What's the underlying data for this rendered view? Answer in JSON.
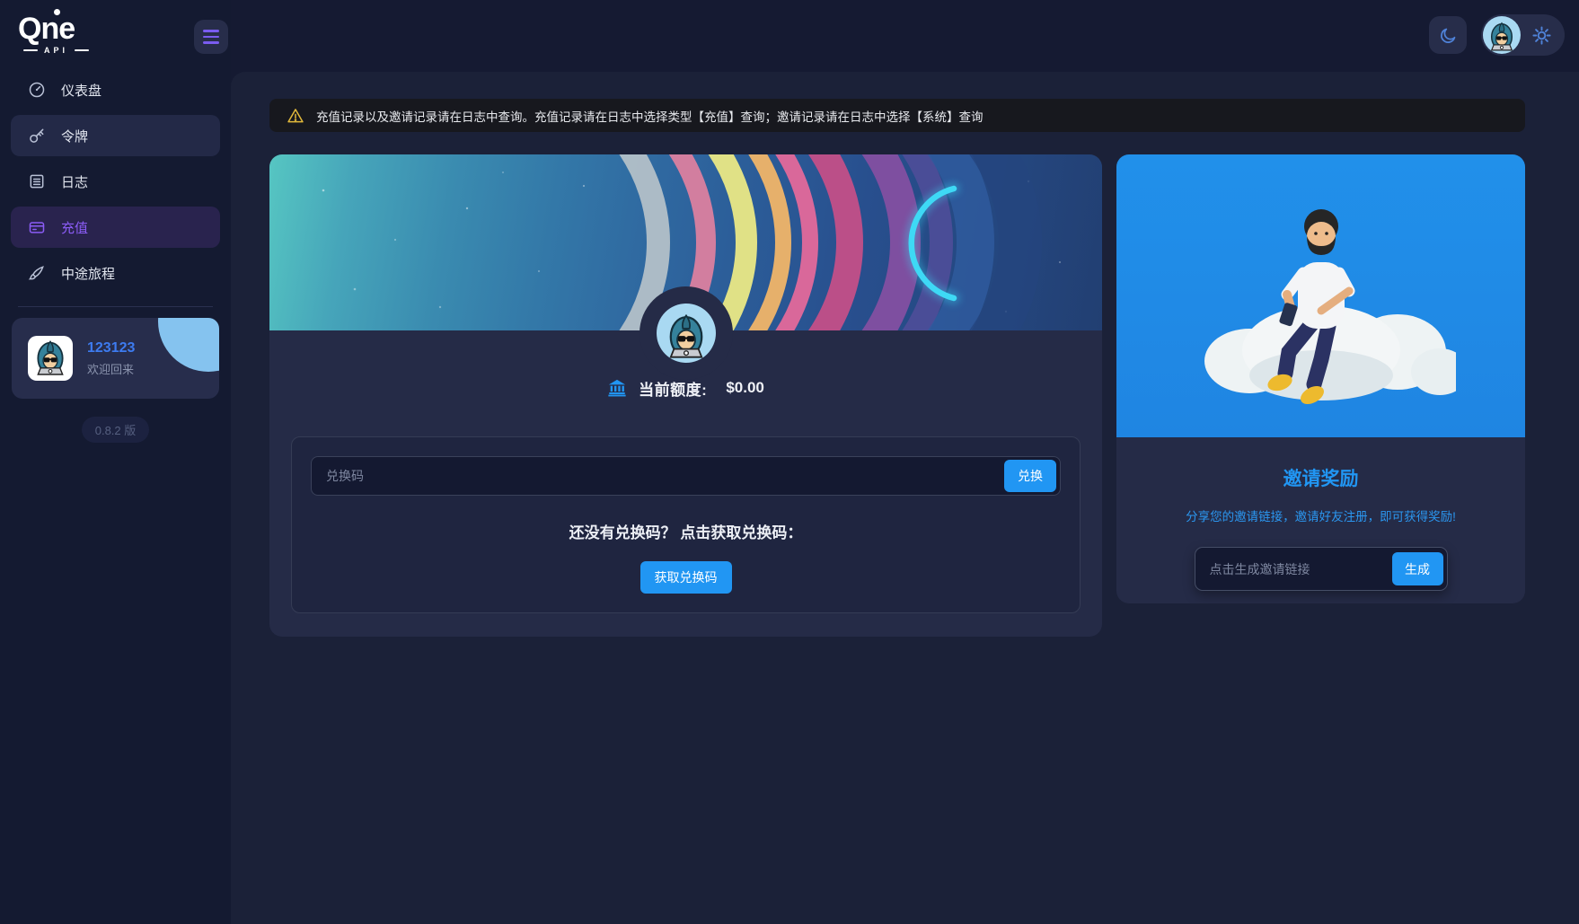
{
  "brand": {
    "name": "Qne",
    "sub": "API"
  },
  "sidebar": {
    "items": [
      {
        "label": "仪表盘",
        "icon": "dashboard-icon",
        "active": false
      },
      {
        "label": "令牌",
        "icon": "key-icon",
        "active": false
      },
      {
        "label": "日志",
        "icon": "log-icon",
        "active": false
      },
      {
        "label": "充值",
        "icon": "credit-card-icon",
        "active": true
      },
      {
        "label": "中途旅程",
        "icon": "brush-icon",
        "active": false
      }
    ],
    "user": {
      "name": "123123",
      "greeting": "欢迎回来"
    },
    "version": "0.8.2 版"
  },
  "topbar": {
    "icons": {
      "menu": "menu-icon",
      "theme": "moon-icon",
      "settings": "gear-icon",
      "avatar": "user-avatar"
    }
  },
  "notice": {
    "icon": "warning-icon",
    "text": "充值记录以及邀请记录请在日志中查询。充值记录请在日志中选择类型【充值】查询；邀请记录请在日志中选择【系统】查询"
  },
  "recharge": {
    "balance_icon": "bank-icon",
    "balance_label": "当前额度:",
    "balance_value": "$0.00",
    "redeem_placeholder": "兑换码",
    "redeem_button": "兑换",
    "hint": "还没有兑换码？ 点击获取兑换码：",
    "get_code_button": "获取兑换码"
  },
  "invite": {
    "title": "邀请奖励",
    "subtitle": "分享您的邀请链接，邀请好友注册，即可获得奖励!",
    "link_placeholder": "点击生成邀请链接",
    "generate_button": "生成"
  },
  "colors": {
    "accent_blue": "#2196f3",
    "accent_purple": "#8b5cf6",
    "invite_hero_blue": "#2190ea",
    "warning_yellow": "#e2b93b",
    "page_bg": "#151a32",
    "content_bg": "#1b2138",
    "card_bg": "#252b47",
    "username_blue": "#3d7bf0"
  }
}
